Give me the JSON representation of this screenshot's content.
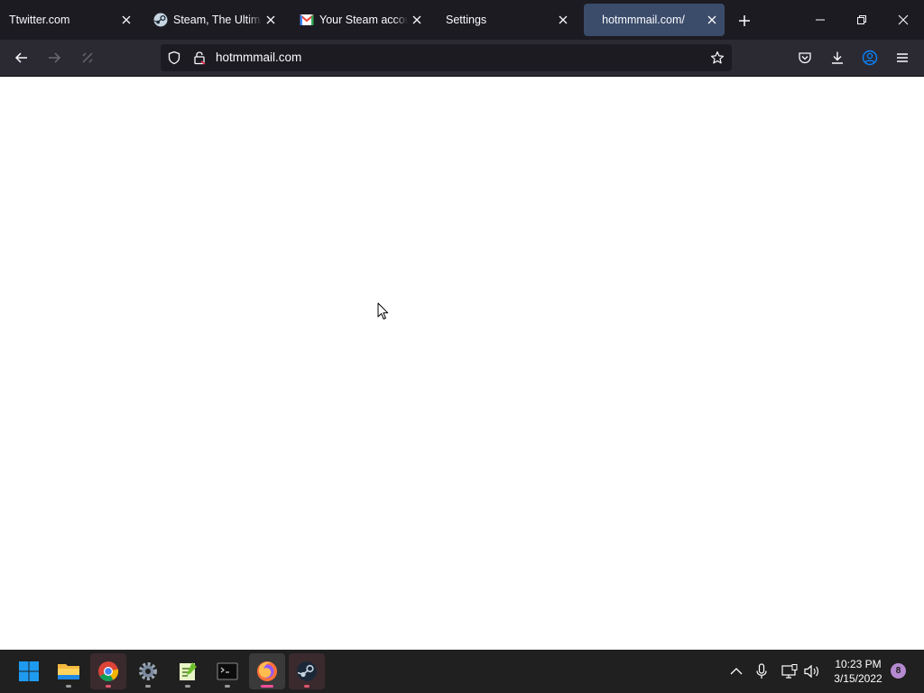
{
  "tabs": [
    {
      "label": "Ttwitter.com",
      "icon": "none",
      "active": false
    },
    {
      "label": "Steam, The Ultimate Online Game Platform",
      "icon": "steam-icon",
      "active": false
    },
    {
      "label": "Your Steam account",
      "icon": "gmail-icon",
      "active": false
    },
    {
      "label": "Settings",
      "icon": "none",
      "active": false
    },
    {
      "label": "hotmmmail.com/",
      "icon": "none",
      "active": true
    }
  ],
  "address_bar": {
    "url": "hotmmmail.com"
  },
  "taskbar": {
    "apps": [
      "windows-start",
      "file-explorer",
      "chrome",
      "settings",
      "notepad-plus",
      "terminal",
      "firefox",
      "steam"
    ],
    "clock_time": "10:23 PM",
    "clock_date": "3/15/2022",
    "notification_count": "8"
  },
  "colors": {
    "tabstrip": "#1c1b22",
    "navbar": "#2b2a33",
    "active_tab": "#3b4c6b",
    "taskbar": "#202020",
    "accent": "#0078d4"
  }
}
